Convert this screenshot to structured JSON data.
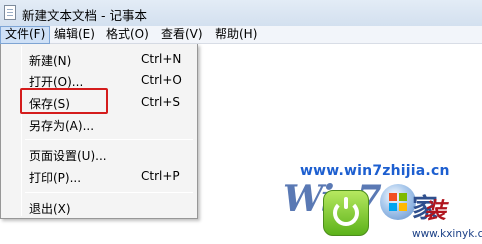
{
  "window": {
    "title": "新建文本文档 - 记事本"
  },
  "menubar": {
    "items": [
      "文件(F)",
      "编辑(E)",
      "格式(O)",
      "查看(V)",
      "帮助(H)"
    ]
  },
  "file_menu": {
    "items": [
      {
        "label": "新建(N)",
        "shortcut": "Ctrl+N"
      },
      {
        "label": "打开(O)...",
        "shortcut": "Ctrl+O"
      },
      {
        "label": "保存(S)",
        "shortcut": "Ctrl+S"
      },
      {
        "label": "另存为(A)...",
        "shortcut": ""
      },
      {
        "label": "页面设置(U)...",
        "shortcut": ""
      },
      {
        "label": "打印(P)...",
        "shortcut": "Ctrl+P"
      },
      {
        "label": "退出(X)",
        "shortcut": ""
      }
    ]
  },
  "watermark": {
    "url": "www.win7zhijia.cn",
    "logo_text": "Win7",
    "brand": "装",
    "house_glyph": "家",
    "site": "www.kxinyk.com"
  },
  "colors": {
    "highlight_box": "#d41c1c",
    "menu_active": "#cfe1f7",
    "watermark_url": "#1d5fd0"
  }
}
